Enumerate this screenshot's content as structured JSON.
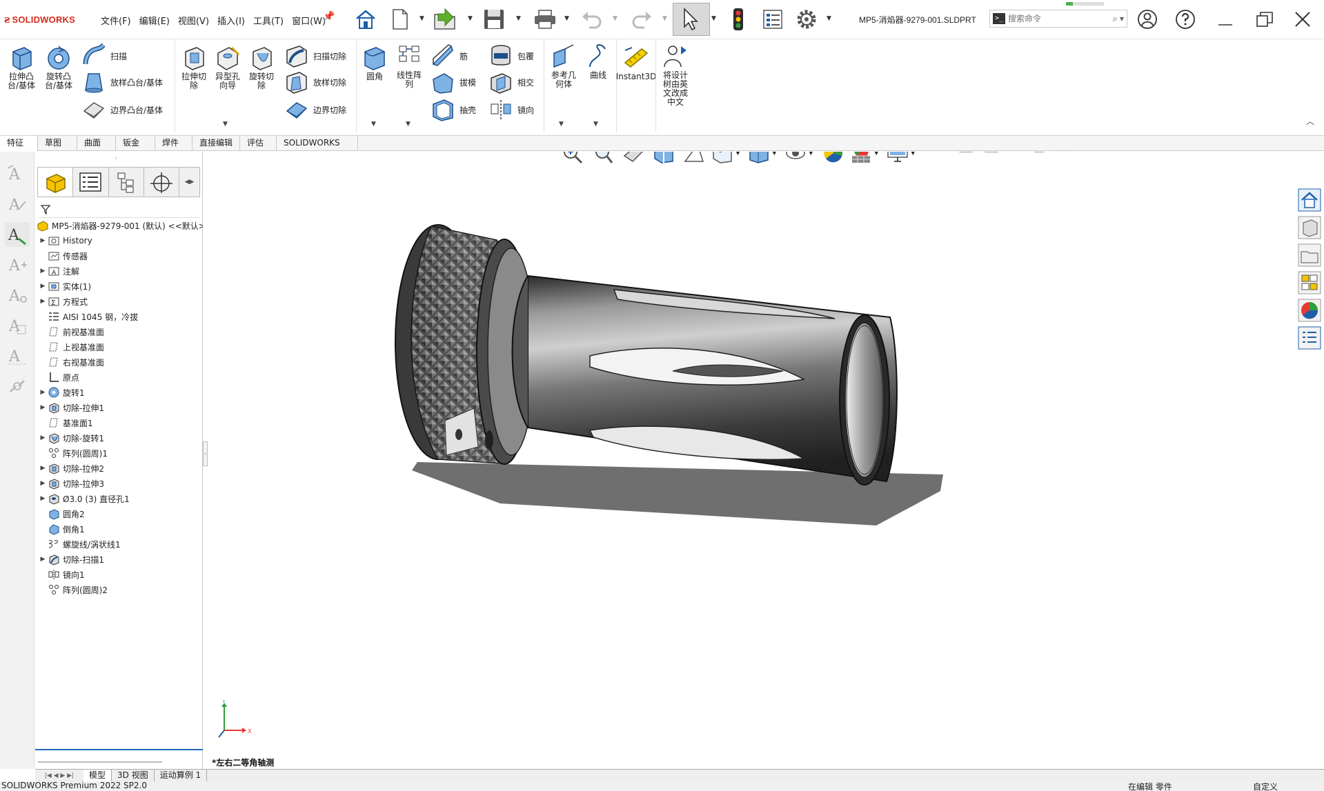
{
  "app": {
    "brand": "SOLIDWORKS",
    "document_title": "MP5-消焰器-9279-001.SLDPRT"
  },
  "menus": [
    "文件(F)",
    "编辑(E)",
    "视图(V)",
    "插入(I)",
    "工具(T)",
    "窗口(W)"
  ],
  "search": {
    "placeholder": "搜索命令"
  },
  "quick_access_icons": [
    "home-icon",
    "new-document-icon",
    "open-icon",
    "save-icon",
    "print-icon",
    "undo-icon",
    "redo-icon",
    "select-icon",
    "rebuild-traffic-light-icon",
    "file-properties-icon",
    "options-gear-icon"
  ],
  "ribbon": {
    "extrude_boss": "拉伸凸\n台/基体",
    "revolve_boss": "旋转凸\n台/基体",
    "sweep": "扫描",
    "loft": "放样凸台/基体",
    "boundary": "边界凸台/基体",
    "extrude_cut": "拉伸切\n除",
    "hole_wizard": "异型孔\n向导",
    "revolve_cut": "旋转切\n除",
    "swept_cut": "扫描切除",
    "lofted_cut": "放样切除",
    "boundary_cut": "边界切除",
    "fillet": "圆角",
    "linear_pattern": "线性阵\n列",
    "rib": "筋",
    "draft": "拔模",
    "shell": "抽壳",
    "wrap": "包覆",
    "intersect": "相交",
    "mirror": "镜向",
    "ref_geometry": "参考几\n何体",
    "curves": "曲线",
    "instant3d": "Instant3D",
    "translate_tree": "将设计\n树由英\n文改成\n中文"
  },
  "command_tabs": [
    "特征",
    "草图",
    "曲面",
    "钣金",
    "焊件",
    "直接编辑",
    "评估",
    "SOLIDWORKS 插件"
  ],
  "feature_tree": {
    "root": "MP5-消焰器-9279-001 (默认) <<默认>",
    "items": [
      {
        "label": "History",
        "icon": "history-folder-icon",
        "expand": true
      },
      {
        "label": "传感器",
        "icon": "sensors-folder-icon",
        "expand": false
      },
      {
        "label": "注解",
        "icon": "annotations-folder-icon",
        "expand": true
      },
      {
        "label": "实体(1)",
        "icon": "solid-bodies-folder-icon",
        "expand": true
      },
      {
        "label": "方程式",
        "icon": "equations-folder-icon",
        "expand": true
      },
      {
        "label": "AISI 1045 钢，冷拔",
        "icon": "material-icon",
        "expand": false
      },
      {
        "label": "前视基准面",
        "icon": "plane-icon",
        "expand": false
      },
      {
        "label": "上视基准面",
        "icon": "plane-icon",
        "expand": false
      },
      {
        "label": "右视基准面",
        "icon": "plane-icon",
        "expand": false
      },
      {
        "label": "原点",
        "icon": "origin-icon",
        "expand": false
      },
      {
        "label": "旋转1",
        "icon": "revolve-feature-icon",
        "expand": true
      },
      {
        "label": "切除-拉伸1",
        "icon": "cut-extrude-icon",
        "expand": true
      },
      {
        "label": "基准面1",
        "icon": "plane-icon",
        "expand": false
      },
      {
        "label": "切除-旋转1",
        "icon": "cut-revolve-icon",
        "expand": true
      },
      {
        "label": "阵列(圆周)1",
        "icon": "circular-pattern-icon",
        "expand": false
      },
      {
        "label": "切除-拉伸2",
        "icon": "cut-extrude-icon",
        "expand": true
      },
      {
        "label": "切除-拉伸3",
        "icon": "cut-extrude-icon",
        "expand": true
      },
      {
        "label": "Ø3.0 (3) 直径孔1",
        "icon": "hole-icon",
        "expand": true
      },
      {
        "label": "圆角2",
        "icon": "fillet-icon",
        "expand": false
      },
      {
        "label": "倒角1",
        "icon": "chamfer-icon",
        "expand": false
      },
      {
        "label": "螺旋线/涡状线1",
        "icon": "helix-icon",
        "expand": false
      },
      {
        "label": "切除-扫描1",
        "icon": "cut-sweep-icon",
        "expand": true
      },
      {
        "label": "镜向1",
        "icon": "mirror-icon",
        "expand": false
      },
      {
        "label": "阵列(圆周)2",
        "icon": "circular-pattern-icon",
        "expand": false
      }
    ]
  },
  "triad": {
    "y": "Y",
    "x": "X"
  },
  "view_orientation": "*左右二等角轴测",
  "bottom_tabs": [
    "模型",
    "3D 视图",
    "运动算例 1"
  ],
  "status": {
    "left": "SOLIDWORKS Premium 2022 SP2.0",
    "mode": "在编辑 零件",
    "units": "自定义"
  }
}
